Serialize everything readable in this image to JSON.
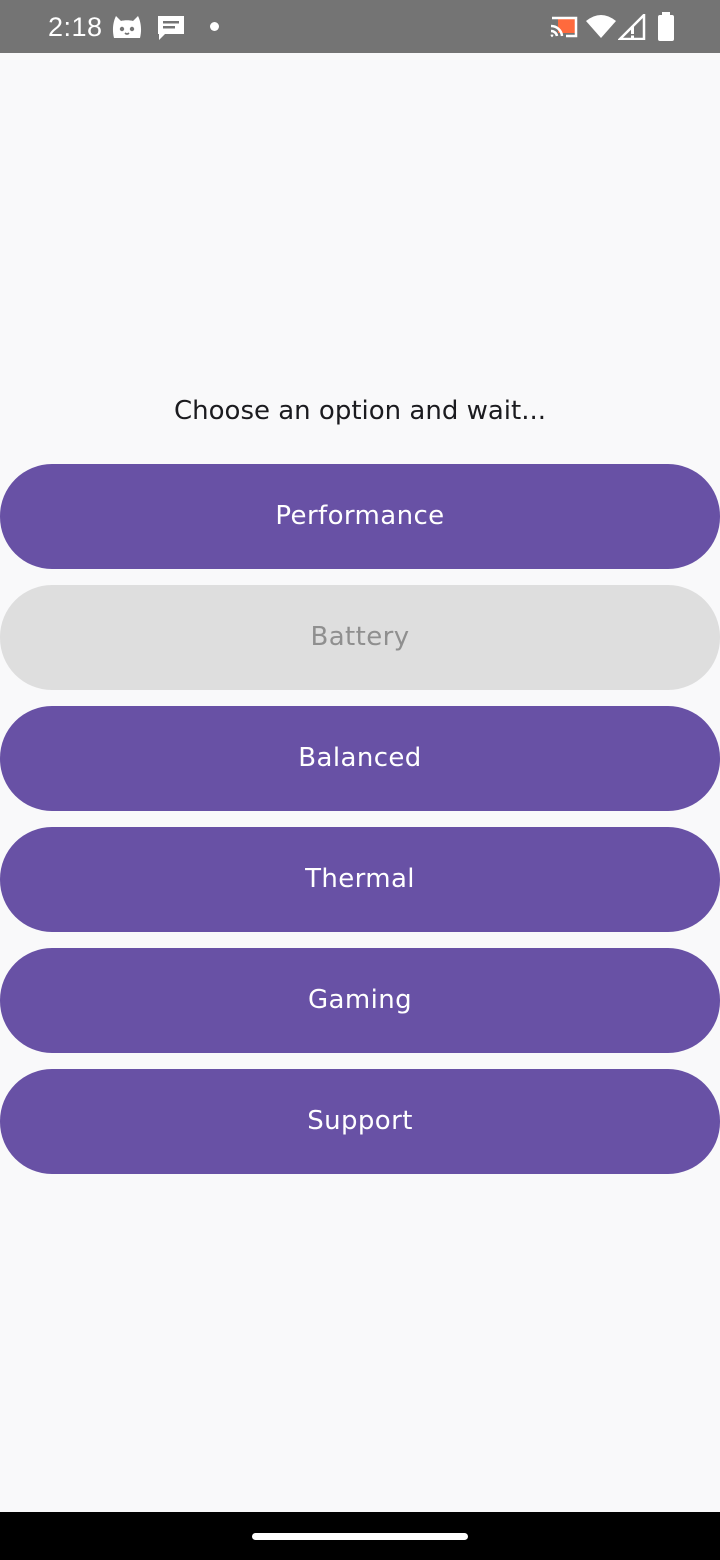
{
  "status_bar": {
    "time": "2:18",
    "left_icons": [
      "cat-app-icon",
      "message-icon",
      "notification-dot-icon"
    ],
    "right_icons": [
      "cast-icon",
      "wifi-icon",
      "signal-icon",
      "battery-icon"
    ],
    "background_color": "#747474",
    "cast_accent_color": "#ff6a3d"
  },
  "main": {
    "prompt": "Choose an option and wait...",
    "options": [
      {
        "label": "Performance",
        "enabled": true
      },
      {
        "label": "Battery",
        "enabled": false
      },
      {
        "label": "Balanced",
        "enabled": true
      },
      {
        "label": "Thermal",
        "enabled": true
      },
      {
        "label": "Gaming",
        "enabled": true
      },
      {
        "label": "Support",
        "enabled": true
      }
    ],
    "colors": {
      "button": "#6851a5",
      "button_text": "#ffffff",
      "button_disabled": "#dedede",
      "button_disabled_text": "#8f8f8f",
      "background": "#f9f9fa"
    }
  },
  "nav_bar": {
    "type": "gesture-handle"
  }
}
